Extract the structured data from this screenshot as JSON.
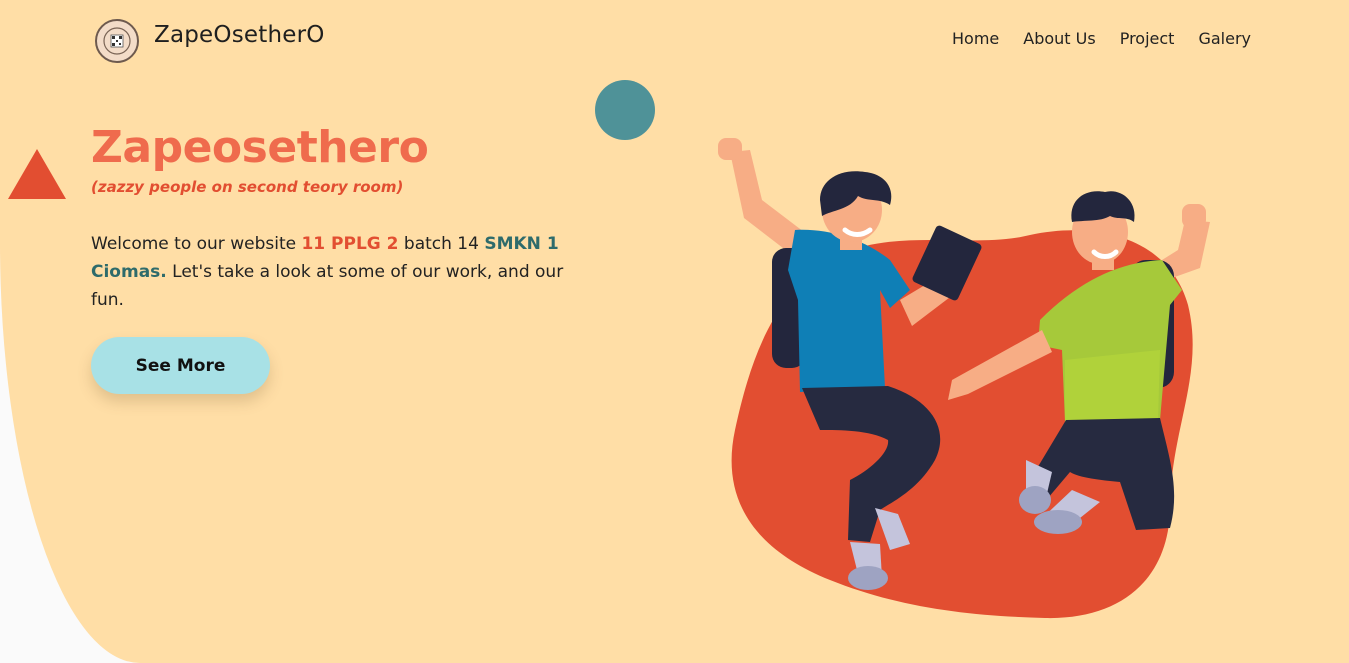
{
  "navbar": {
    "brand": "ZapeOsetherO",
    "links": [
      "Home",
      "About Us",
      "Project",
      "Galery"
    ]
  },
  "hero": {
    "title": "Zapeosethero",
    "subtitle": "(zazzy people on second teory room)",
    "welcome_prefix": "Welcome to our website ",
    "class_name": "11 PPLG 2",
    "welcome_mid": " batch 14 ",
    "school_name": "SMKN 1 Ciomas.",
    "welcome_suffix": " Let's take a look at some of our work, and our fun.",
    "button_label": "See More"
  },
  "colors": {
    "background": "#ffdea6",
    "accent_red": "#e24e31",
    "title": "#ef6b4d",
    "teal": "#4f9298",
    "button": "#a8e1e6"
  },
  "icons": {
    "logo": "school-badge-icon",
    "illustration": "jumping-students-illustration"
  }
}
